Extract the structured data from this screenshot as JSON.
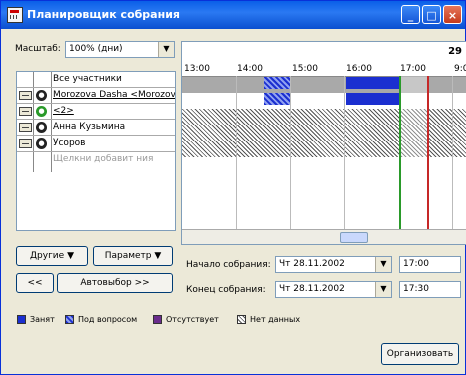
{
  "window": {
    "title": "Планировщик собрания",
    "minimize": "_",
    "maximize": "□",
    "close": "×"
  },
  "scale": {
    "label": "Масштаб:",
    "value": "100% (дни)"
  },
  "attendees": {
    "header": "Все участники",
    "rows": [
      {
        "name": "Morozova Dasha <Morozova",
        "icon": "●"
      },
      {
        "name": "<2>",
        "icon": "●"
      },
      {
        "name": "Анна Кузьмина",
        "icon": "●"
      },
      {
        "name": "Усоров",
        "icon": "●"
      }
    ],
    "add_placeholder": "Щелкни добавит ния"
  },
  "timeline": {
    "date_fragment": "29",
    "hours": [
      "13:00",
      "14:00",
      "15:00",
      "16:00",
      "17:00",
      "9:0"
    ]
  },
  "buttons": {
    "others": "Другие",
    "options": "Параметр",
    "prev": "<<",
    "autopick": "Автовыбор >>",
    "organize": "Организовать"
  },
  "meeting": {
    "start_label": "Начало собрания:",
    "start_date": "Чт 28.11.2002",
    "start_time": "17:00",
    "end_label": "Конец собрания:",
    "end_date": "Чт 28.11.2002",
    "end_time": "17:30"
  },
  "legend": [
    {
      "label": "Занят",
      "color": "#1b2fd0"
    },
    {
      "label": "Под вопросом",
      "color": "#1b2fd0"
    },
    {
      "label": "Отсутствует",
      "color": "#6a2c8c"
    },
    {
      "label": "Нет данных",
      "color": "#ffffff"
    }
  ]
}
